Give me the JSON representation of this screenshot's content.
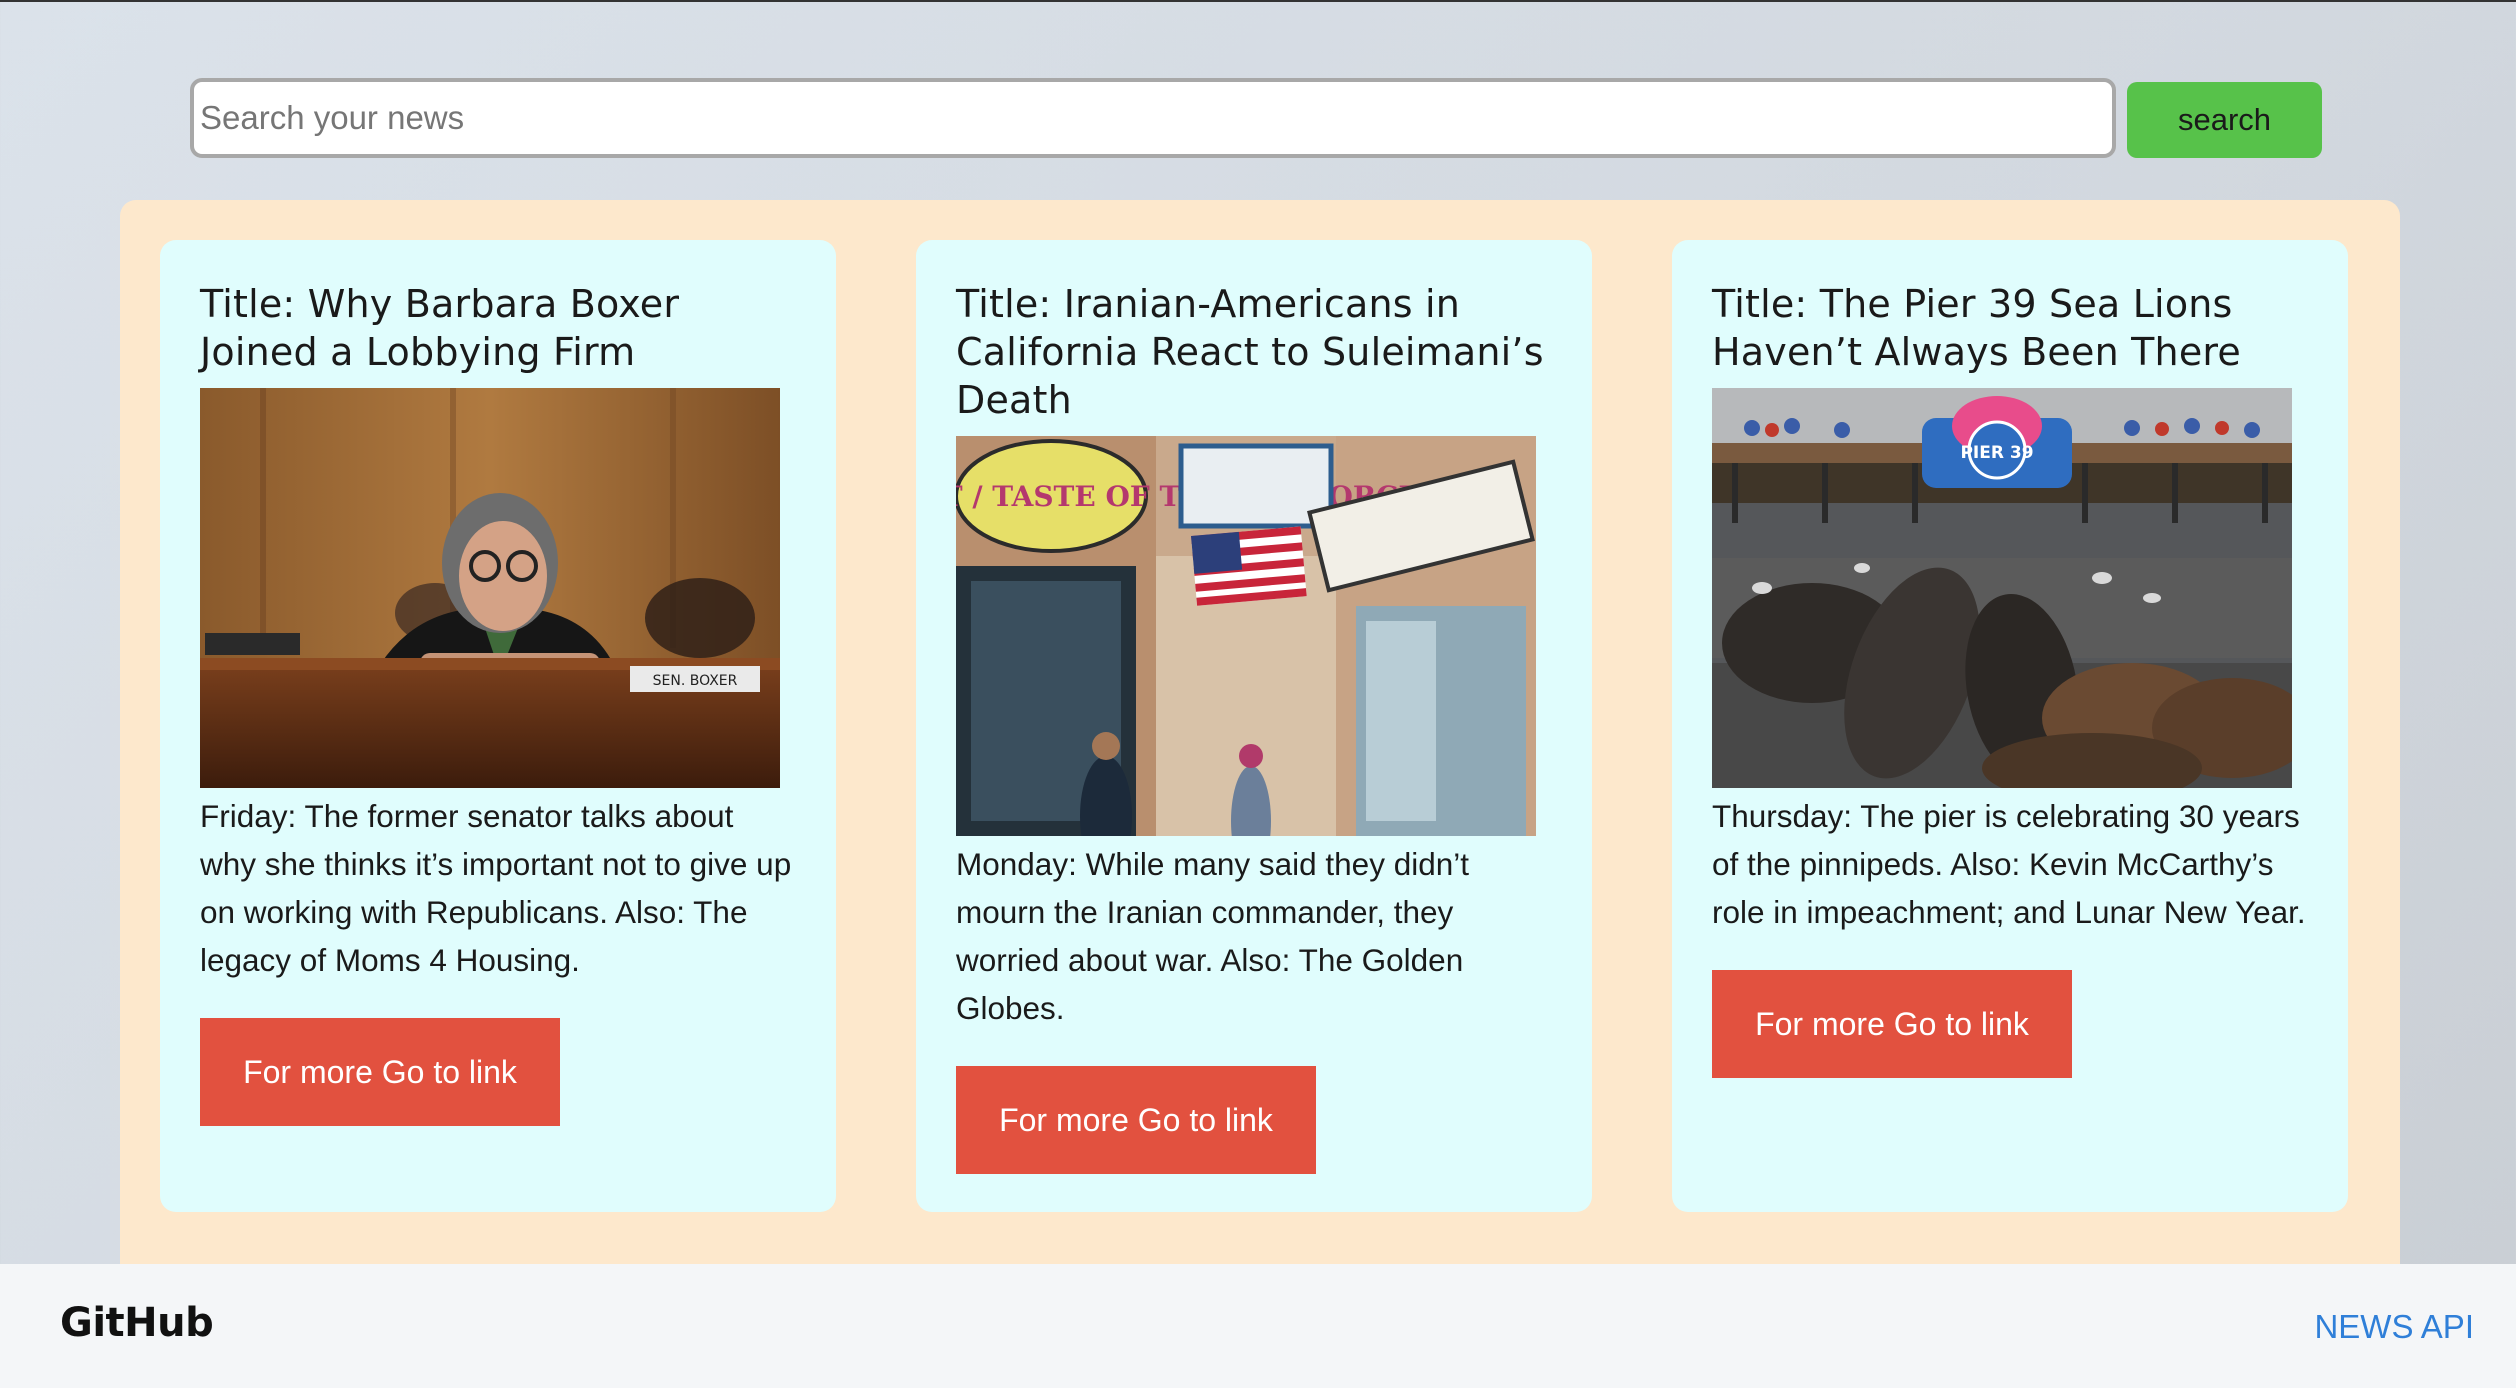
{
  "search": {
    "placeholder": "Search your news",
    "button_label": "search"
  },
  "articles": [
    {
      "title": "Title: Why Barbara Boxer Joined a Lobbying Firm",
      "image": "senator-at-hearing-photo",
      "description": "Friday: The former senator talks about why she thinks it’s important not to give up on working with Republicans. Also: The legacy of Moms 4 Housing.",
      "link_label": "For more Go to link",
      "image_text": "SEN. BOXER"
    },
    {
      "title": "Title: Iranian-Americans in California React to Suleimani’s Death",
      "image": "westwood-storefronts-photo",
      "description": "Monday: While many said they didn’t mourn the Iranian commander, they worried about war. Also: The Golden Globes.",
      "link_label": "For more Go to link",
      "image_text": "WESTWOOD COURT / TASTE OF TEHRAN / ORCHID"
    },
    {
      "title": "Title: The Pier 39 Sea Lions Haven’t Always Been There",
      "image": "sea-lions-on-docks-photo",
      "description": "Thursday: The pier is celebrating 30 years of the pinnipeds. Also: Kevin McCarthy’s role in impeachment; and Lunar New Year.",
      "link_label": "For more Go to link",
      "image_text": "PIER 39"
    }
  ],
  "footer": {
    "logo_text": "GitHub",
    "link_label": "NEWS API"
  },
  "colors": {
    "search_button": "#57c24a",
    "panel_background": "#fde8cc",
    "card_background": "#e0fdfd",
    "link_button": "#e2513f",
    "footer_link": "#2f7fd8"
  }
}
